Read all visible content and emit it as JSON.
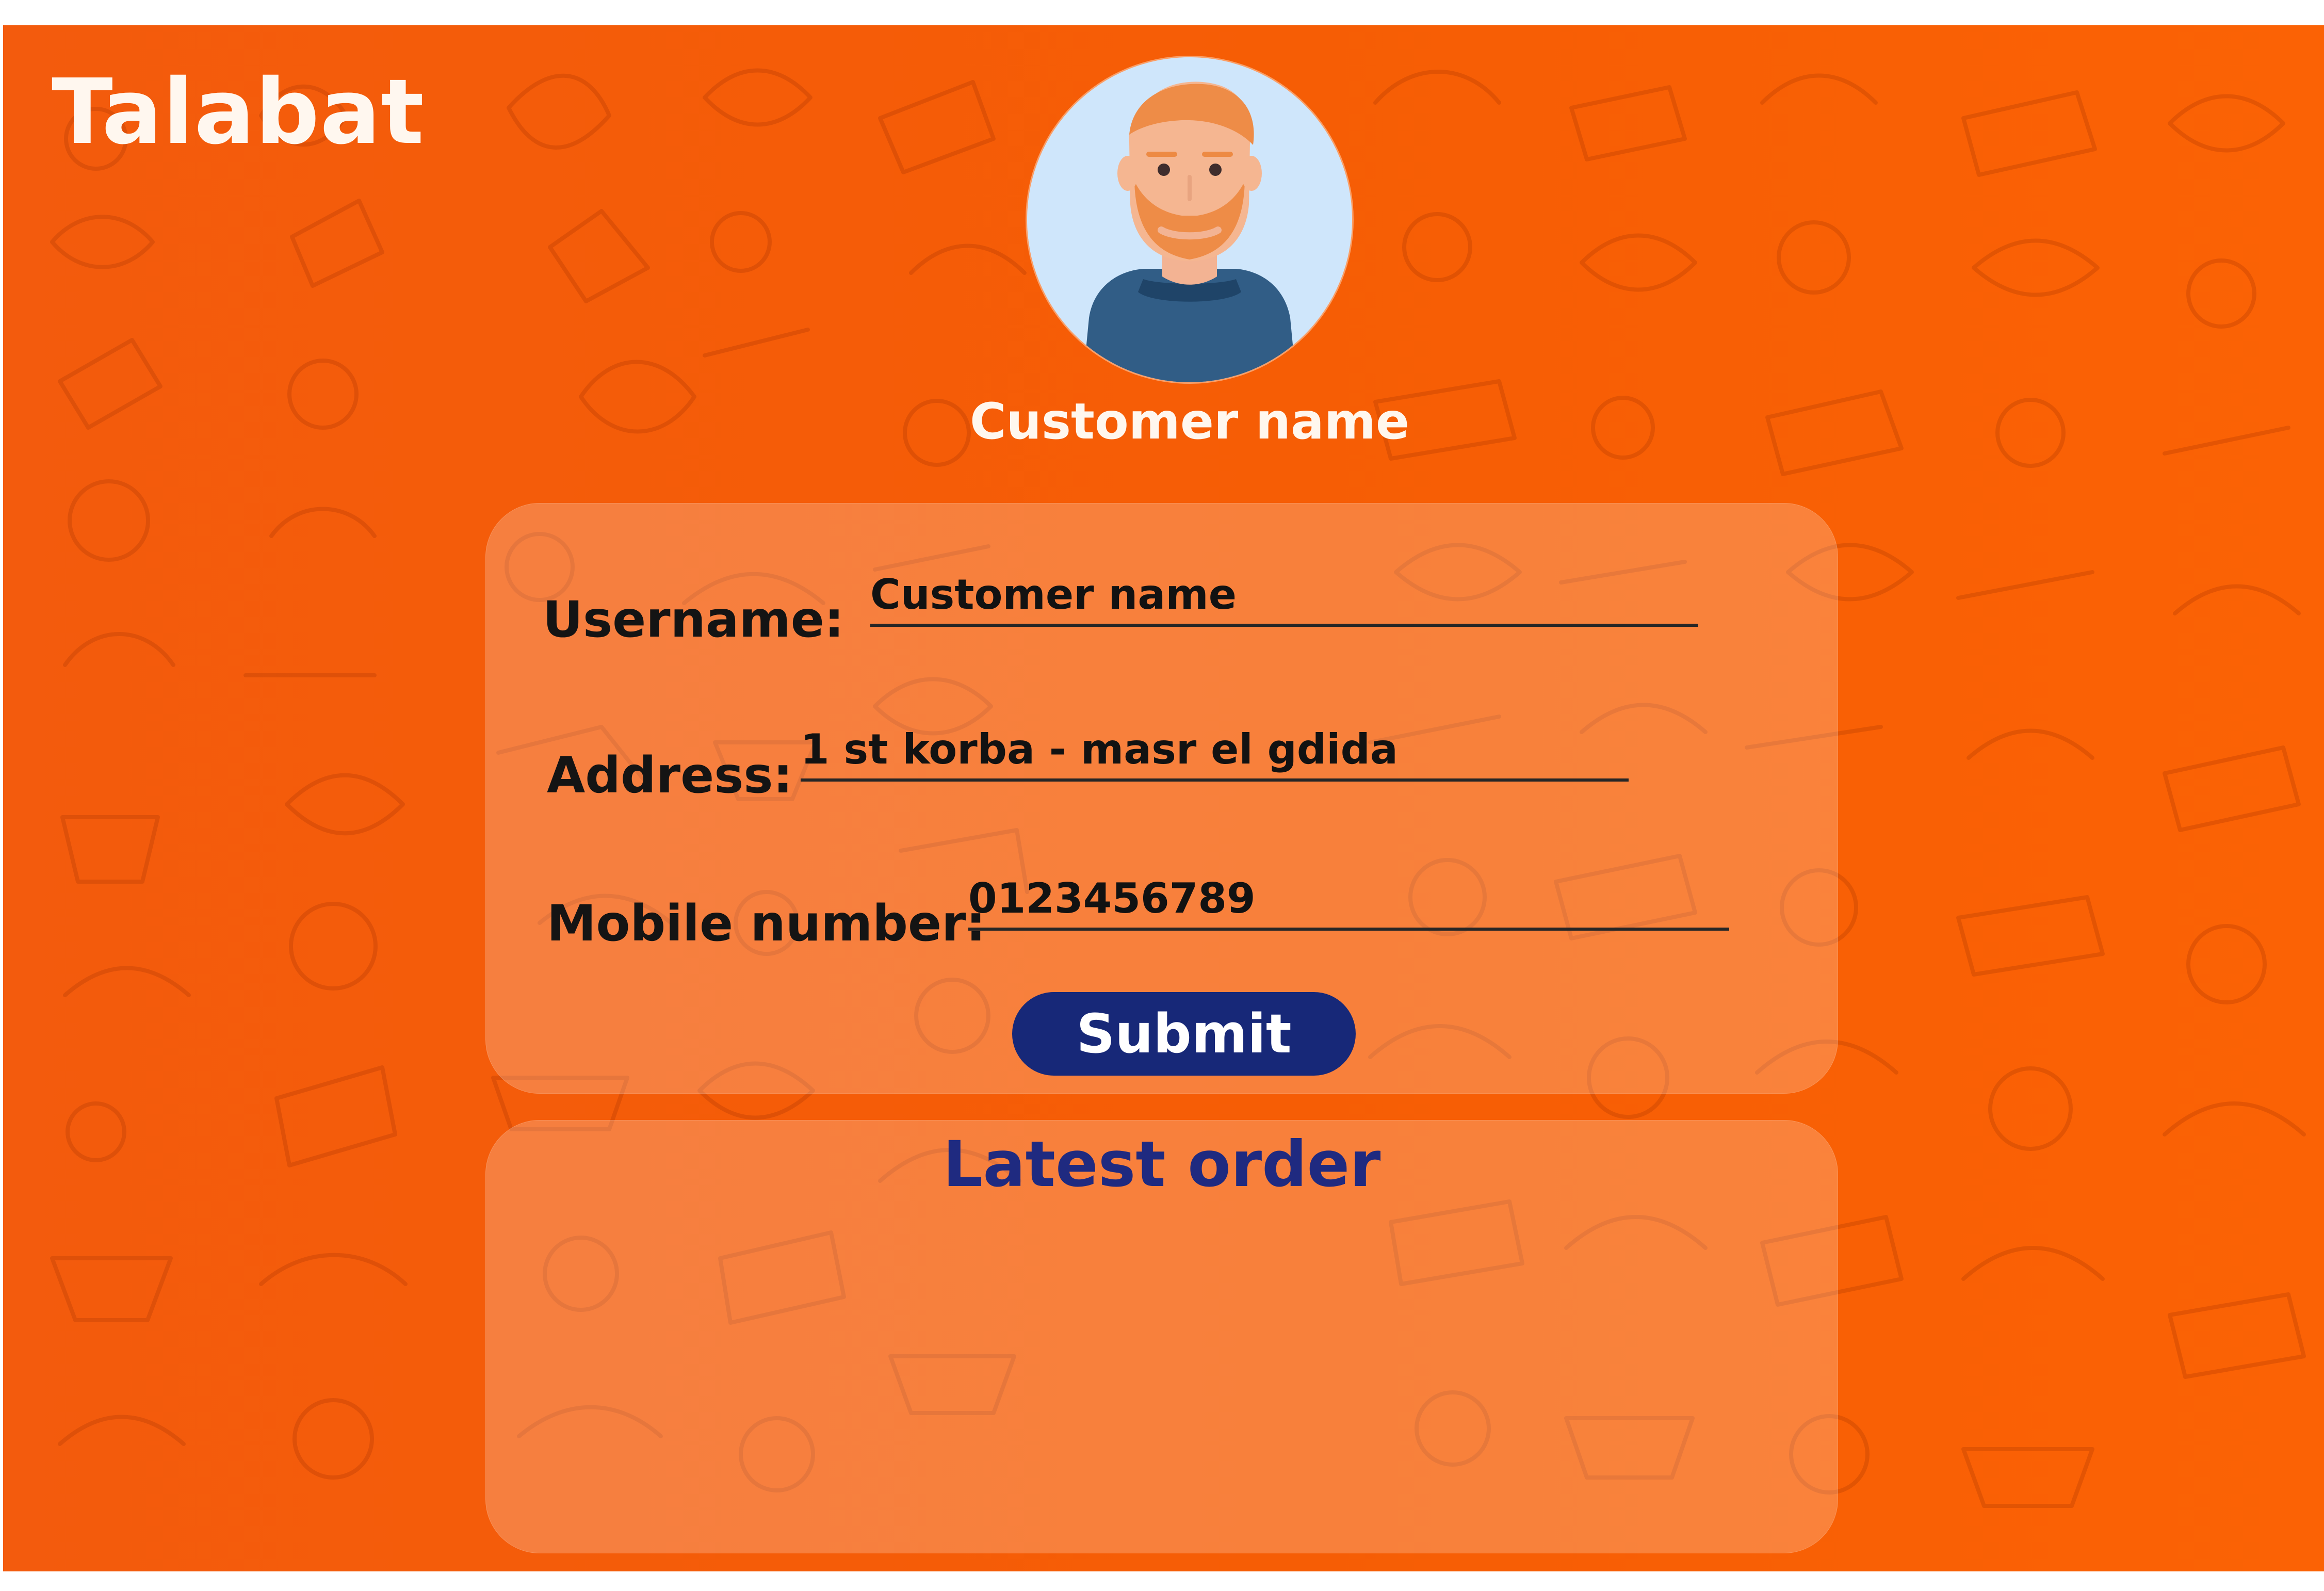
{
  "brand": {
    "name": "Talabat"
  },
  "profile": {
    "title": "Customer name",
    "avatar_icon": "user-avatar-icon"
  },
  "form": {
    "fields": [
      {
        "label": "Username:",
        "value": "Customer name"
      },
      {
        "label": "Address:",
        "value": "1 st korba - masr el gdida"
      },
      {
        "label": "Mobile number:",
        "value": "0123456789"
      }
    ],
    "submit_label": "Submit"
  },
  "latest_order": {
    "title": "Latest order"
  },
  "colors": {
    "background_orange": "#f65d05",
    "panel_overlay": "rgba(255,255,255,0.22)",
    "brand_text": "#fff7ef",
    "submit_blue": "#172878",
    "latest_title_blue": "#1f2a80",
    "field_text": "#121212"
  }
}
